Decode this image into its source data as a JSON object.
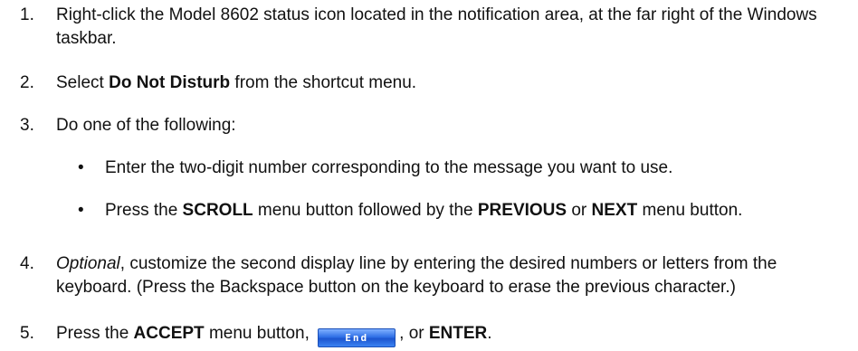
{
  "steps": [
    {
      "number": "1.",
      "text": "Right-click the Model 8602 status icon located in the notification area, at the far right of the Windows taskbar."
    },
    {
      "number": "2.",
      "pre": "Select ",
      "bold": "Do Not Disturb",
      "post": " from the shortcut menu."
    },
    {
      "number": "3.",
      "text": "Do one of the following:",
      "bullets": [
        {
          "marker": "•",
          "text": "Enter the two-digit number corresponding to the message you want to use."
        },
        {
          "marker": "•",
          "pre": "Press the ",
          "bold1": "SCROLL",
          "mid": " menu button followed by the ",
          "bold2": "PREVIOUS",
          "mid2": " or ",
          "bold3": "NEXT",
          "post": " menu button."
        }
      ]
    },
    {
      "number": "4.",
      "italic": "Optional",
      "post": ", customize the second display line by entering the desired numbers or letters from the keyboard. (Press the Backspace button on the keyboard to erase the previous character.)"
    },
    {
      "number": "5.",
      "pre": "Press the ",
      "bold1": "ACCEPT",
      "mid": " menu button, ",
      "button_label": "End",
      "mid2": ", or ",
      "bold2": "ENTER",
      "post": "."
    }
  ]
}
